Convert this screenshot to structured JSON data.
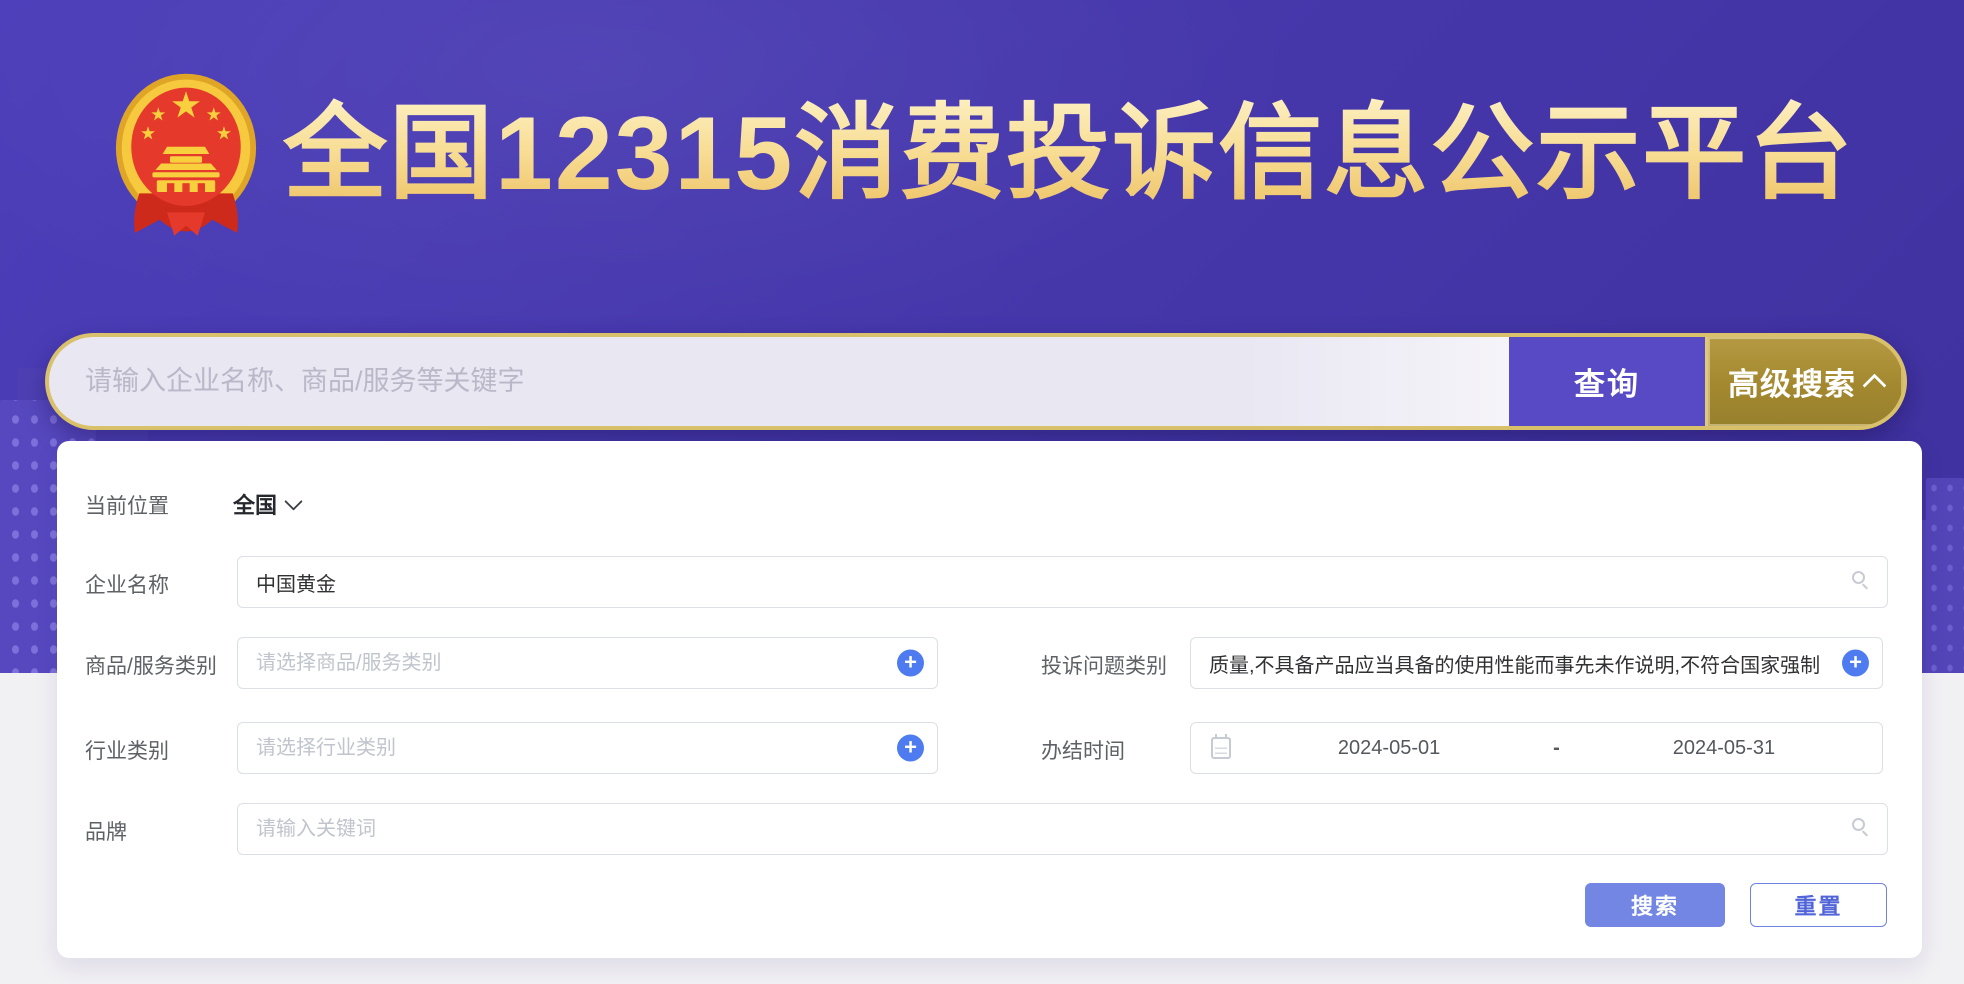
{
  "header": {
    "platform_title": "全国12315消费投诉信息公示平台",
    "emblem": "china-national-emblem"
  },
  "search_bar": {
    "placeholder": "请输入企业名称、商品/服务等关键字",
    "query_label": "查询",
    "advanced_label": "高级搜索",
    "advanced_state_icon": "chevron-up-icon"
  },
  "filters": {
    "location": {
      "label": "当前位置",
      "value": "全国"
    },
    "company_name": {
      "label": "企业名称",
      "value": "中国黄金",
      "icon": "search-icon"
    },
    "product_service_category": {
      "label": "商品/服务类别",
      "placeholder": "请选择商品/服务类别",
      "icon": "plus-icon"
    },
    "complaint_issue_category": {
      "label": "投诉问题类别",
      "value": "质量,不具备产品应当具备的使用性能而事先未作说明,不符合国家强制",
      "icon": "plus-icon"
    },
    "industry_category": {
      "label": "行业类别",
      "placeholder": "请选择行业类别",
      "icon": "plus-icon"
    },
    "completion_time": {
      "label": "办结时间",
      "start_date": "2024-05-01",
      "separator": "-",
      "end_date": "2024-05-31",
      "icon": "calendar-icon"
    },
    "brand": {
      "label": "品牌",
      "placeholder": "请输入关键词",
      "icon": "search-icon"
    }
  },
  "actions": {
    "search_label": "搜索",
    "reset_label": "重置"
  },
  "colors": {
    "hero_purple": "#4638AC",
    "gold_border": "#D9C16B",
    "title_gold": "#F6D98C",
    "query_button_purple": "#574AC4",
    "advanced_button_gold": "#A3882F",
    "accent_blue": "#4E7CF0",
    "search_button_periwinkle": "#7486E4",
    "input_border": "#DCDFE6",
    "label_gray": "#5E6166",
    "page_background": "#F1F0F3"
  }
}
